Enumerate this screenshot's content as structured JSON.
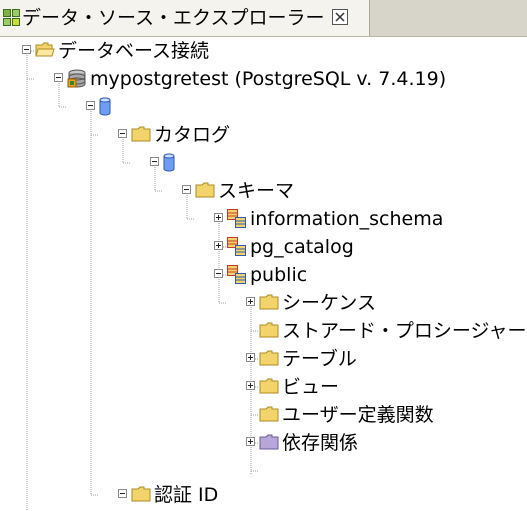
{
  "tab": {
    "title": "データ・ソース・エクスプローラー",
    "close_label": "⊠"
  },
  "tree": {
    "root": "データベース接続",
    "connection": "mypostgretest (PostgreSQL v. 7.4.19)",
    "catalog_folder": "カタログ",
    "schema_folder": "スキーマ",
    "schemas": [
      "information_schema",
      "pg_catalog",
      "public"
    ],
    "public_children": [
      "シーケンス",
      "ストアード・プロシージャー",
      "テーブル",
      "ビュー",
      "ユーザー定義関数",
      "依存関係"
    ],
    "auth_folder": "認証 ID"
  },
  "icons": {
    "tab": "database-explorer-icon",
    "folder": "folder-icon",
    "database": "database-icon",
    "schema": "schema-icon",
    "close": "close-icon"
  },
  "colors": {
    "folder": "#f3d46a",
    "folder_dependency": "#b7a6d8",
    "tab_background": "#f4f3ee",
    "tabbar_background": "#d7d4c9"
  }
}
